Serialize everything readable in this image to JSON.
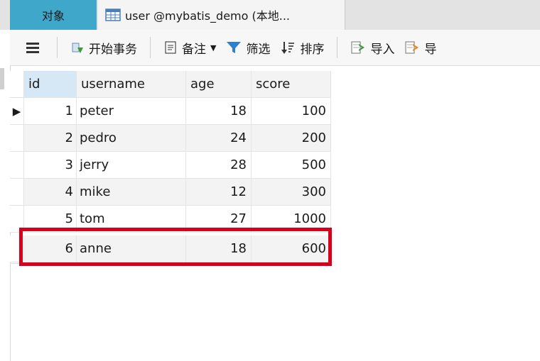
{
  "tabs": {
    "objects_label": "对象",
    "table_tab_label": "user @mybatis_demo (本地..."
  },
  "toolbar": {
    "begin_transaction_label": "开始事务",
    "memo_label": "备注",
    "filter_label": "筛选",
    "sort_label": "排序",
    "import_label": "导入",
    "export_label_partial": "导"
  },
  "grid": {
    "columns": [
      "id",
      "username",
      "age",
      "score"
    ],
    "rows": [
      {
        "id": "1",
        "username": "peter",
        "age": "18",
        "score": "100"
      },
      {
        "id": "2",
        "username": "pedro",
        "age": "24",
        "score": "200"
      },
      {
        "id": "3",
        "username": "jerry",
        "age": "28",
        "score": "500"
      },
      {
        "id": "4",
        "username": "mike",
        "age": "12",
        "score": "300"
      },
      {
        "id": "5",
        "username": "tom",
        "age": "27",
        "score": "1000"
      },
      {
        "id": "6",
        "username": "anne",
        "age": "18",
        "score": "600"
      }
    ],
    "current_row_marker": "▶"
  },
  "colors": {
    "active_tab_bg": "#3fa7c9",
    "header_id_bg": "#d6e7f5",
    "highlight_box": "#d6001c",
    "filter_icon": "#2f7fd1",
    "begin_tx_icon": "#3c9a3c"
  },
  "icons": {
    "menu": "hamburger-icon",
    "table": "table-grid-icon",
    "begin_transaction": "begin-transaction-icon",
    "memo": "memo-icon",
    "filter": "filter-funnel-icon",
    "sort": "sort-icon",
    "import": "import-icon",
    "export": "export-icon"
  }
}
